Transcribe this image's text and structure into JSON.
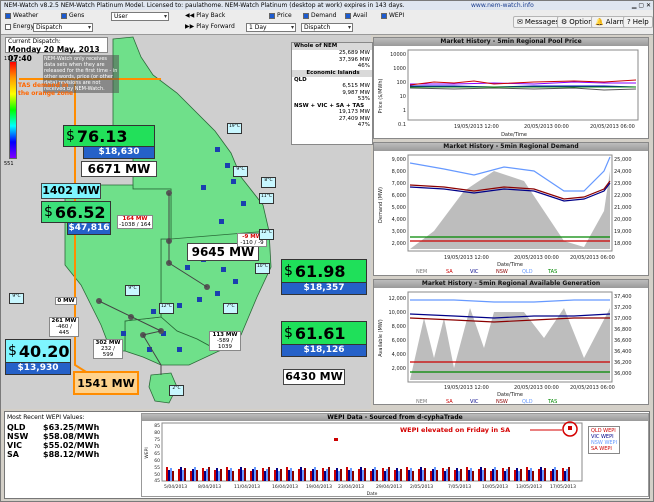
{
  "window": {
    "title": "NEM-Watch v8.2.5 NEM-Watch Platinum Model.  Licensed to: paulathome.  NEM-Watch Platinum (desktop at work) expires in 143 days.",
    "url": "www.nem-watch.info"
  },
  "toolbar": {
    "checks": [
      "Weather",
      "Gens",
      "Energy",
      "Dispatch"
    ],
    "user_select": "User",
    "time_select": "1 Day",
    "dispatch_select": "Dispatch",
    "play_back": "Play Back",
    "play_forward": "Play Forward",
    "price_label": "Price",
    "demand_label": "Demand",
    "avail_label": "Avail",
    "wepi_label": "WEPI",
    "messages": "Messages",
    "options": "Options",
    "alarms": "Alarms",
    "help": "Help"
  },
  "dispatch": {
    "label": "Current Dispatch:",
    "value": "Monday 20 May, 2013 07:40"
  },
  "scale": {
    "top": "1781",
    "bottom": "551"
  },
  "note_text": "NEM-Watch only receives data sets when they are released for the first time - in other words, price (or other data) revisions are not received by NEM-Watch.",
  "annotation": "TAS demand in the orange zone",
  "regions": {
    "qld": {
      "price": "76.13",
      "wepi": "$18,630",
      "demand": "6671 MW"
    },
    "sa": {
      "price": "66.52",
      "wepi": "$47,816",
      "demand": "1402 MW"
    },
    "nsw": {
      "price": "61.98",
      "wepi": "$18,357",
      "demand": "9645 MW"
    },
    "vic": {
      "price": "61.61",
      "wepi": "$18,126",
      "demand": "6430 MW"
    },
    "tas": {
      "price": "40.20",
      "wepi": "$13,930",
      "demand": "1541 MW"
    }
  },
  "flows": [
    {
      "mw": "164 MW",
      "range": "-1038 / 164"
    },
    {
      "mw": "-9 MW",
      "range": "-110 / -9"
    },
    {
      "mw": "0 MW",
      "range": ""
    },
    {
      "mw": "261 MW",
      "range": "-460 / 445"
    },
    {
      "mw": "302 MW",
      "range": "232 / 599"
    },
    {
      "mw": "113 MW",
      "range": "-589 / 1039"
    }
  ],
  "stations": [
    "19°C",
    "9°C",
    "8°C",
    "11°C",
    "12°C",
    "10°C",
    "9°C",
    "12°C",
    "7°C",
    "9°C",
    "2°C"
  ],
  "nem_table": {
    "whole_header": "Whole of NEM",
    "whole": [
      "25,689 MW",
      "37,396 MW",
      "46%"
    ],
    "islands_header": "Economic Islands",
    "qld_label": "QLD",
    "qld": [
      "6,515 MW",
      "9,987 MW",
      "53%"
    ],
    "nsw_label": "NSW + VIC + SA + TAS",
    "nsw": [
      "19,173 MW",
      "27,409 MW",
      "47%"
    ]
  },
  "price_chart": {
    "title": "Market History - 5min Regional Pool Price",
    "ylabel": "Price ($/MWh)",
    "xlabel": "Date/Time",
    "x_ticks": [
      "19/05/2013 12:00",
      "20/05/2013 00:00",
      "20/05/2013 06:00"
    ],
    "y_ticks": [
      "10000",
      "1000",
      "100",
      "10",
      "1",
      "0.1"
    ],
    "legend": [
      "SA",
      "VIC",
      "NSW",
      "QLD",
      "TAS"
    ]
  },
  "demand_chart": {
    "title": "Market History - 5min Regional Demand",
    "ylabel": "Demand (MW)",
    "xlabel": "Date/Time",
    "x_ticks": [
      "19/05/2013 12:00",
      "20/05/2013 00:00",
      "20/05/2013 06:00"
    ],
    "y_ticks": [
      "9,000",
      "8,000",
      "7,000",
      "6,000",
      "5,000",
      "4,000",
      "3,000",
      "2,000",
      "1,000"
    ],
    "y2_ticks": [
      "25,000",
      "24,000",
      "23,000",
      "22,000",
      "21,000",
      "20,000",
      "19,000",
      "18,000",
      "17,000"
    ],
    "legend": [
      "NEM",
      "SA",
      "VIC",
      "NSW",
      "QLD",
      "TAS"
    ]
  },
  "avail_chart": {
    "title": "Market History - 5min Regional Available Generation",
    "ylabel": "Available (MW)",
    "xlabel": "Date/Time",
    "x_ticks": [
      "19/05/2013 12:00",
      "20/05/2013 00:00",
      "20/05/2013 06:00"
    ],
    "y_ticks": [
      "12,000",
      "10,000",
      "8,000",
      "6,000",
      "4,000",
      "2,000"
    ],
    "y2_ticks": [
      "37,400",
      "37,200",
      "37,000",
      "36,800",
      "36,600",
      "36,400",
      "36,200",
      "36,000"
    ],
    "legend": [
      "NEM",
      "SA",
      "VIC",
      "NSW",
      "QLD",
      "TAS"
    ]
  },
  "wepi": {
    "header": "Most Recent WEPI Values:",
    "title": "WEPI Data - Sourced from d-cyphaTrade",
    "rows": [
      {
        "region": "QLD",
        "value": "$63.25/MWh"
      },
      {
        "region": "NSW",
        "value": "$58.08/MWh"
      },
      {
        "region": "VIC",
        "value": "$55.02/MWh"
      },
      {
        "region": "SA",
        "value": "$88.12/MWh"
      }
    ],
    "annotation": "WEPI elevated on Friday in SA",
    "xlabel": "Date",
    "ylabel": "WEPI",
    "x_ticks": [
      "5/04/2013",
      "8/04/2013",
      "11/04/2013",
      "16/04/2013",
      "19/04/2013",
      "23/04/2013",
      "29/04/2013",
      "2/05/2013",
      "7/05/2013",
      "10/05/2013",
      "13/05/2013",
      "17/05/2013"
    ],
    "y_ticks": [
      "85",
      "80",
      "75",
      "70",
      "65",
      "60",
      "55",
      "50",
      "45"
    ],
    "legend": [
      "QLD WEPI",
      "VIC WEPI",
      "NSW WEPI",
      "SA WEPI"
    ]
  }
}
